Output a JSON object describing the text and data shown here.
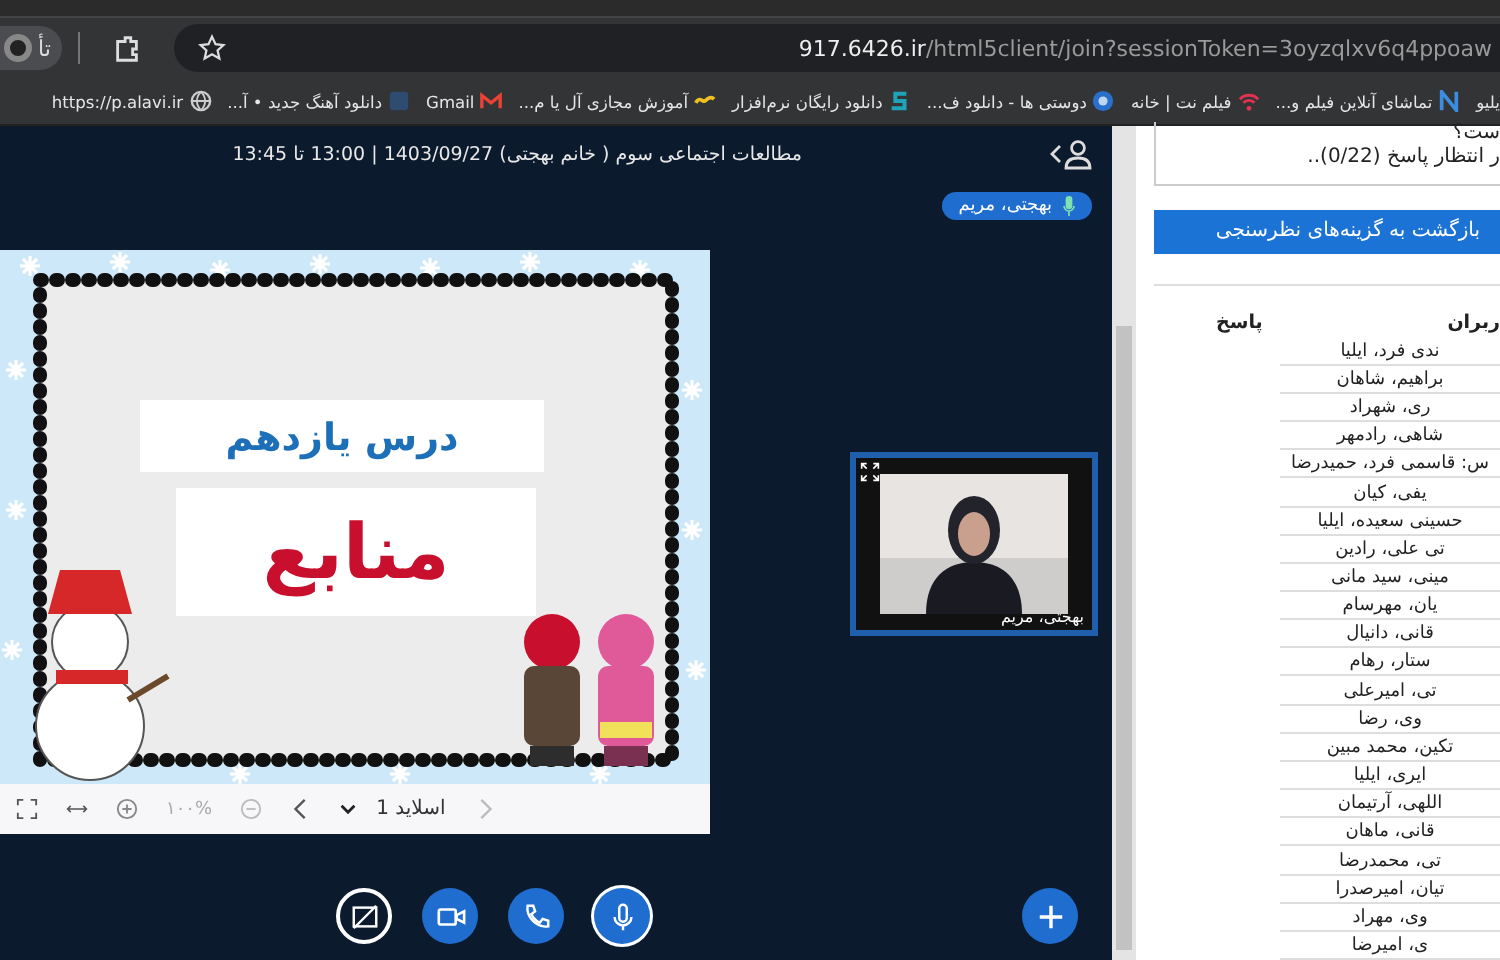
{
  "browser": {
    "tab_fragment": "تأ",
    "url_host": "917.6426.ir",
    "url_path": "/html5client/join?sessionToken=3oyzqlxv6q4ppoaw",
    "bookmarks": [
      {
        "label": "یلیو",
        "kind": "none"
      },
      {
        "label": "تماشای آنلاین فیلم و...",
        "kind": "letter-n"
      },
      {
        "label": "فیلم نت | خانه",
        "kind": "wifi"
      },
      {
        "label": "دوستی ها - دانلود ف...",
        "kind": "badge"
      },
      {
        "label": "دانلود رایگان نرم‌افزار",
        "kind": "letter-s"
      },
      {
        "label": "آموزش مجازی آل یا م...",
        "kind": "wave"
      },
      {
        "label": "Gmail",
        "kind": "mail"
      },
      {
        "label": "دانلود آهنگ جدید • آ...",
        "kind": "square"
      },
      {
        "label": "https://p.alavi.ir",
        "kind": "globe"
      }
    ]
  },
  "meeting": {
    "title": "مطالعات اجتماعی سوم ( خانم بهجتی) 1403/09/27 | 13:00 تا 13:45",
    "presenter": "بهجتی، مریم",
    "slide": {
      "title": "درس یازدهم",
      "heading": "منابع",
      "zoom": "۱۰۰%",
      "page": "اسلاید 1"
    },
    "video": {
      "name": "بهجتی، مریم"
    },
    "controls": [
      {
        "kind": "screen",
        "on": false
      },
      {
        "kind": "camera",
        "on": false
      },
      {
        "kind": "phone",
        "on": false
      },
      {
        "kind": "mic",
        "on": true
      }
    ]
  },
  "poll": {
    "question_fragment": "ست؟",
    "status": "ر انتظار پاسخ (0/22)..",
    "back_button": "بازگشت به گزینه‌های نظرسنجی",
    "columns": [
      "ربران",
      "پاسخ"
    ],
    "rows": [
      "ندی فرد، ایلیا",
      "براهیم، شاهان",
      "ری، شهراد",
      "شاهی، رادمهر",
      "س: قاسمی فرد، حمیدرضا",
      "یفی، کیان",
      "حسینی سعیده، ایلیا",
      "تی علی، رادین",
      "مینی، سید مانی",
      "یان، مهرسام",
      "قانی، دانیال",
      "ستار، رهام",
      "تی، امیرعلی",
      "وی، رضا",
      "تکین، محمد مبین",
      "ایری، ایلیا",
      "اللهی، آرتیمان",
      "قانی، ماهان",
      "تی، محمدرضا",
      "تیان، امیرصدرا",
      "وی، مهراد",
      "ی، امیرضا"
    ]
  }
}
